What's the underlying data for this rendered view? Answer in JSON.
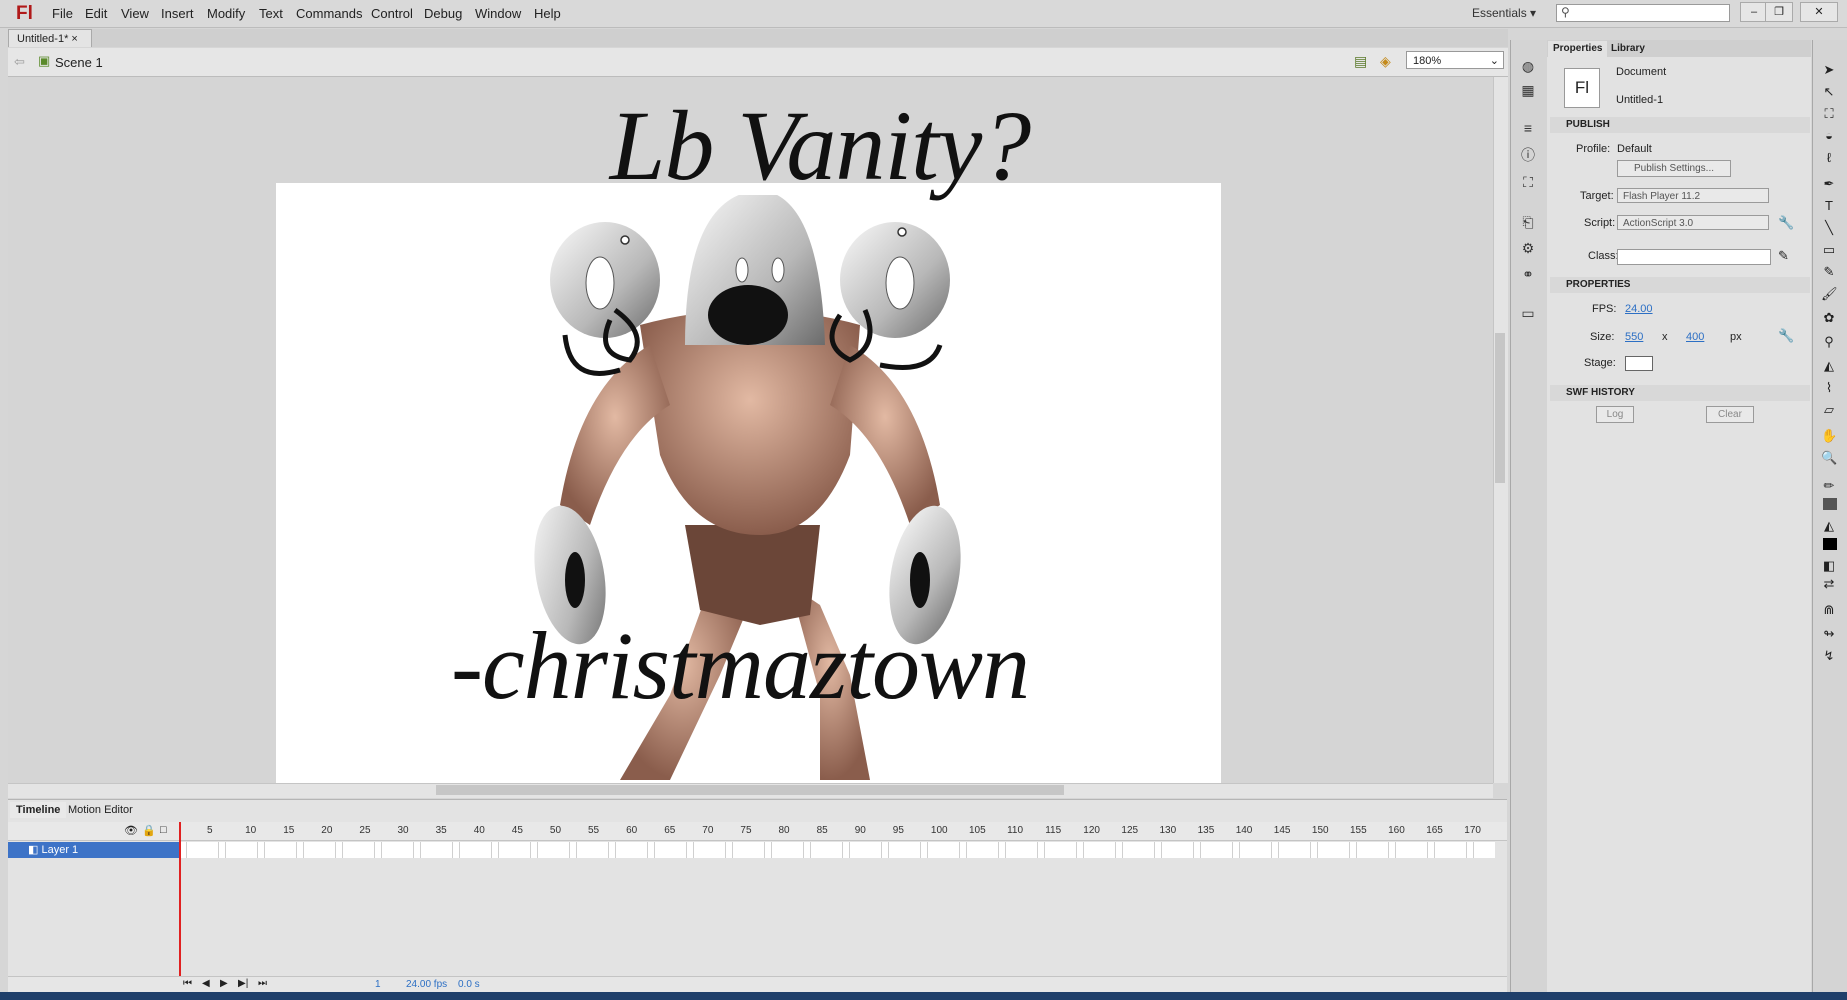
{
  "app": {
    "logo": "Fl"
  },
  "menu": {
    "items": [
      "File",
      "Edit",
      "View",
      "Insert",
      "Modify",
      "Text",
      "Commands",
      "Control",
      "Debug",
      "Window",
      "Help"
    ]
  },
  "workspace": {
    "label": "Essentials",
    "dropdown_icon": "triangle-down"
  },
  "window_buttons": [
    "–",
    "❐",
    "✕"
  ],
  "document": {
    "tab_label": "Untitled-1*",
    "close": "×"
  },
  "editbar": {
    "scene": "Scene 1",
    "zoom": "180%"
  },
  "stage": {
    "title": "Lb Vanity?",
    "author": "-christmaztown"
  },
  "timeline": {
    "tabs": [
      "Timeline",
      "Motion Editor"
    ],
    "layer": "Layer 1",
    "frame_numbers": [
      "5",
      "10",
      "15",
      "20",
      "25",
      "30",
      "35",
      "40",
      "45",
      "50",
      "55",
      "60",
      "65",
      "70",
      "75",
      "80",
      "85",
      "90",
      "95",
      "100",
      "105",
      "110",
      "115",
      "120",
      "125",
      "130",
      "135",
      "140",
      "145",
      "150",
      "155",
      "160",
      "165",
      "170"
    ],
    "current_frame": "1",
    "fps": "24.00 fps",
    "time": "0.0 s"
  },
  "properties": {
    "tabs": [
      "Properties",
      "Library"
    ],
    "doc_type": "Document",
    "doc_name": "Untitled-1",
    "publish": {
      "header": "PUBLISH",
      "profile_label": "Profile:",
      "profile_value": "Default",
      "settings_button": "Publish Settings...",
      "target_label": "Target:",
      "target_value": "Flash Player 11.2",
      "script_label": "Script:",
      "script_value": "ActionScript 3.0",
      "class_label": "Class:"
    },
    "props": {
      "header": "PROPERTIES",
      "fps_label": "FPS:",
      "fps_value": "24.00",
      "size_label": "Size:",
      "width": "550",
      "x": "x",
      "height": "400",
      "unit": "px",
      "stage_label": "Stage:"
    },
    "swf": {
      "header": "SWF HISTORY",
      "log_button": "Log",
      "clear_button": "Clear"
    }
  },
  "colors": {
    "layer_selected": "#3d73c7",
    "playhead": "#e02020",
    "link": "#2c6fc4",
    "logo": "#b01919"
  }
}
